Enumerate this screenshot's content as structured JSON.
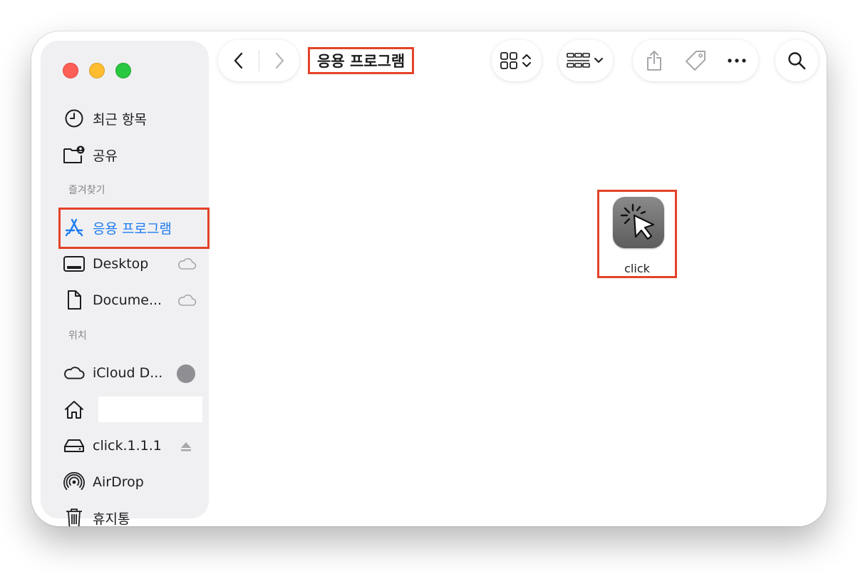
{
  "window": {
    "title": "응용 프로그램"
  },
  "sidebar": {
    "recent": "최근 항목",
    "shared": "공유",
    "favorites_header": "즐겨찾기",
    "favorites": [
      {
        "label": "응용 프로그램",
        "icon": "app-store-icon",
        "active": true
      },
      {
        "label": "Desktop",
        "icon": "desktop-icon",
        "cloud": true
      },
      {
        "label": "Docume...",
        "icon": "document-icon",
        "cloud": true
      }
    ],
    "locations_header": "위치",
    "locations": [
      {
        "label": "iCloud D...",
        "icon": "cloud-icon"
      },
      {
        "label": "",
        "icon": "home-icon"
      },
      {
        "label": "click.1.1.1",
        "icon": "drive-icon"
      },
      {
        "label": "AirDrop",
        "icon": "airdrop-icon"
      },
      {
        "label": "휴지통",
        "icon": "trash-icon"
      }
    ]
  },
  "files": [
    {
      "name": "click",
      "icon": "cursor-click-icon"
    }
  ],
  "colors": {
    "accent": "#1d7cf2",
    "highlight": "#e34329",
    "close": "#ff5f57",
    "minimize": "#febc2e",
    "zoom": "#28c840"
  }
}
